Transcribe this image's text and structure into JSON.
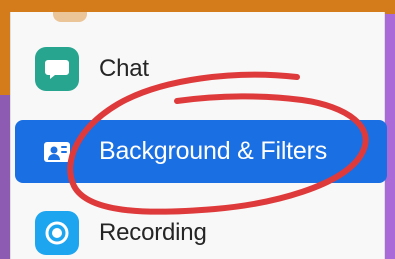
{
  "menu": {
    "items": [
      {
        "key": "chat",
        "label": "Chat",
        "icon": "chat-icon",
        "color": "#27a58f"
      },
      {
        "key": "background",
        "label": "Background & Filters",
        "icon": "background-filters-icon",
        "color": "#1a6fe3",
        "selected": true
      },
      {
        "key": "recording",
        "label": "Recording",
        "icon": "recording-icon",
        "color": "#1ea5f0"
      }
    ]
  },
  "annotation": {
    "color": "#df3a3b"
  }
}
